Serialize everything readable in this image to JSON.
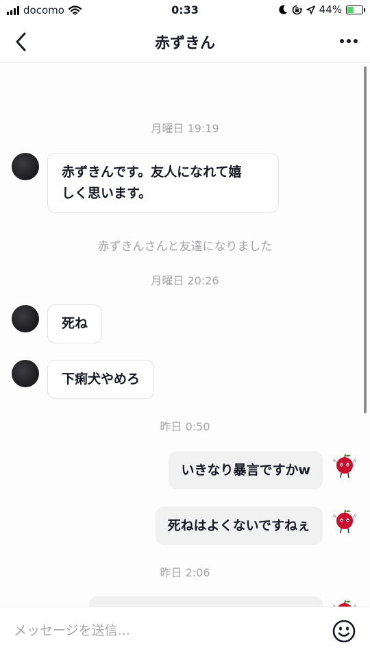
{
  "status_bar": {
    "carrier": "docomo",
    "time": "0:33",
    "battery": "44%",
    "battery_level": 0.44
  },
  "header": {
    "title": "赤ずきん"
  },
  "chat": {
    "messages": [
      {
        "kind": "timestamp",
        "text": "月曜日 19:19"
      },
      {
        "kind": "incoming",
        "lines": [
          "赤ずきんです。友人になれて嬉",
          "しく思います。"
        ]
      },
      {
        "kind": "system",
        "text": "赤ずきんさんと友達になりました"
      },
      {
        "kind": "timestamp",
        "text": "月曜日 20:26"
      },
      {
        "kind": "incoming",
        "text": "死ね"
      },
      {
        "kind": "incoming",
        "text": "下痢犬やめろ"
      },
      {
        "kind": "timestamp",
        "text": "昨日 0:50"
      },
      {
        "kind": "outgoing",
        "text": "いきなり暴言ですかw"
      },
      {
        "kind": "outgoing",
        "text": "死ねはよくないですねぇ"
      },
      {
        "kind": "timestamp",
        "text": "昨日 2:06"
      },
      {
        "kind": "outgoing",
        "text": ""
      }
    ]
  },
  "input": {
    "placeholder": "メッセージを送信..."
  },
  "icons": {
    "back": "chevron-left-icon",
    "more": "more-horizontal-icon",
    "emoji": "smiley-icon",
    "signal": "cellular-signal-icon",
    "wifi": "wifi-icon",
    "moon": "moon-icon",
    "rotation_lock": "rotation-lock-icon",
    "location": "location-arrow-icon",
    "battery": "battery-charging-icon"
  },
  "colors": {
    "outgoing_bubble": "#f1f1f2",
    "incoming_bubble": "#ffffff",
    "meta_text": "#a3a3a6",
    "battery_fill": "#4cd964"
  }
}
